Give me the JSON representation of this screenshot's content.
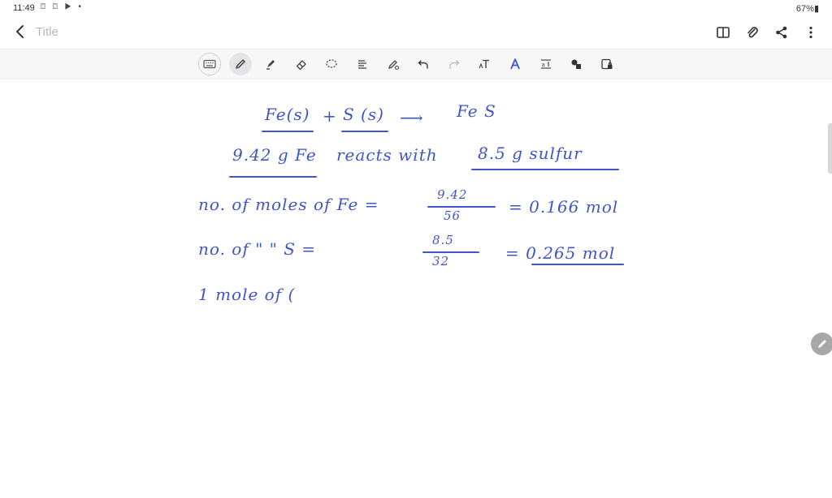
{
  "status_bar": {
    "time": "11:49",
    "indicators": "⌼ ⌼ ▶ •",
    "battery": "67%▮"
  },
  "app_bar": {
    "back_icon": "chevron-left-icon",
    "title_placeholder": "Title"
  },
  "toolbar": {
    "tools": [
      "keyboard",
      "pen",
      "highlighter",
      "eraser",
      "lasso",
      "text-align",
      "shape-pen",
      "undo",
      "redo",
      "text",
      "color",
      "insert-text",
      "shapes",
      "image"
    ]
  },
  "note": {
    "line1": {
      "left": "Fe(s)",
      "plus": "+",
      "right": "S (s)",
      "arrow": "⟶",
      "product": "Fe S"
    },
    "line2": {
      "mass_fe": "9.42 g Fe",
      "verb": "reacts with",
      "mass_s": "8.5 g sulfur"
    },
    "line3": {
      "label": "no. of moles of Fe =",
      "numerator": "9.42",
      "denominator": "56",
      "result": "= 0.166 mol"
    },
    "line4": {
      "label": "no. of  \"   \"  S =",
      "numerator": "8.5",
      "denominator": "32",
      "result": "= 0.265 mol"
    },
    "line5": {
      "text": "1 mole of ("
    }
  },
  "colors": {
    "ink": "#4055c8",
    "toolbar_bg": "#f7f7f7"
  }
}
